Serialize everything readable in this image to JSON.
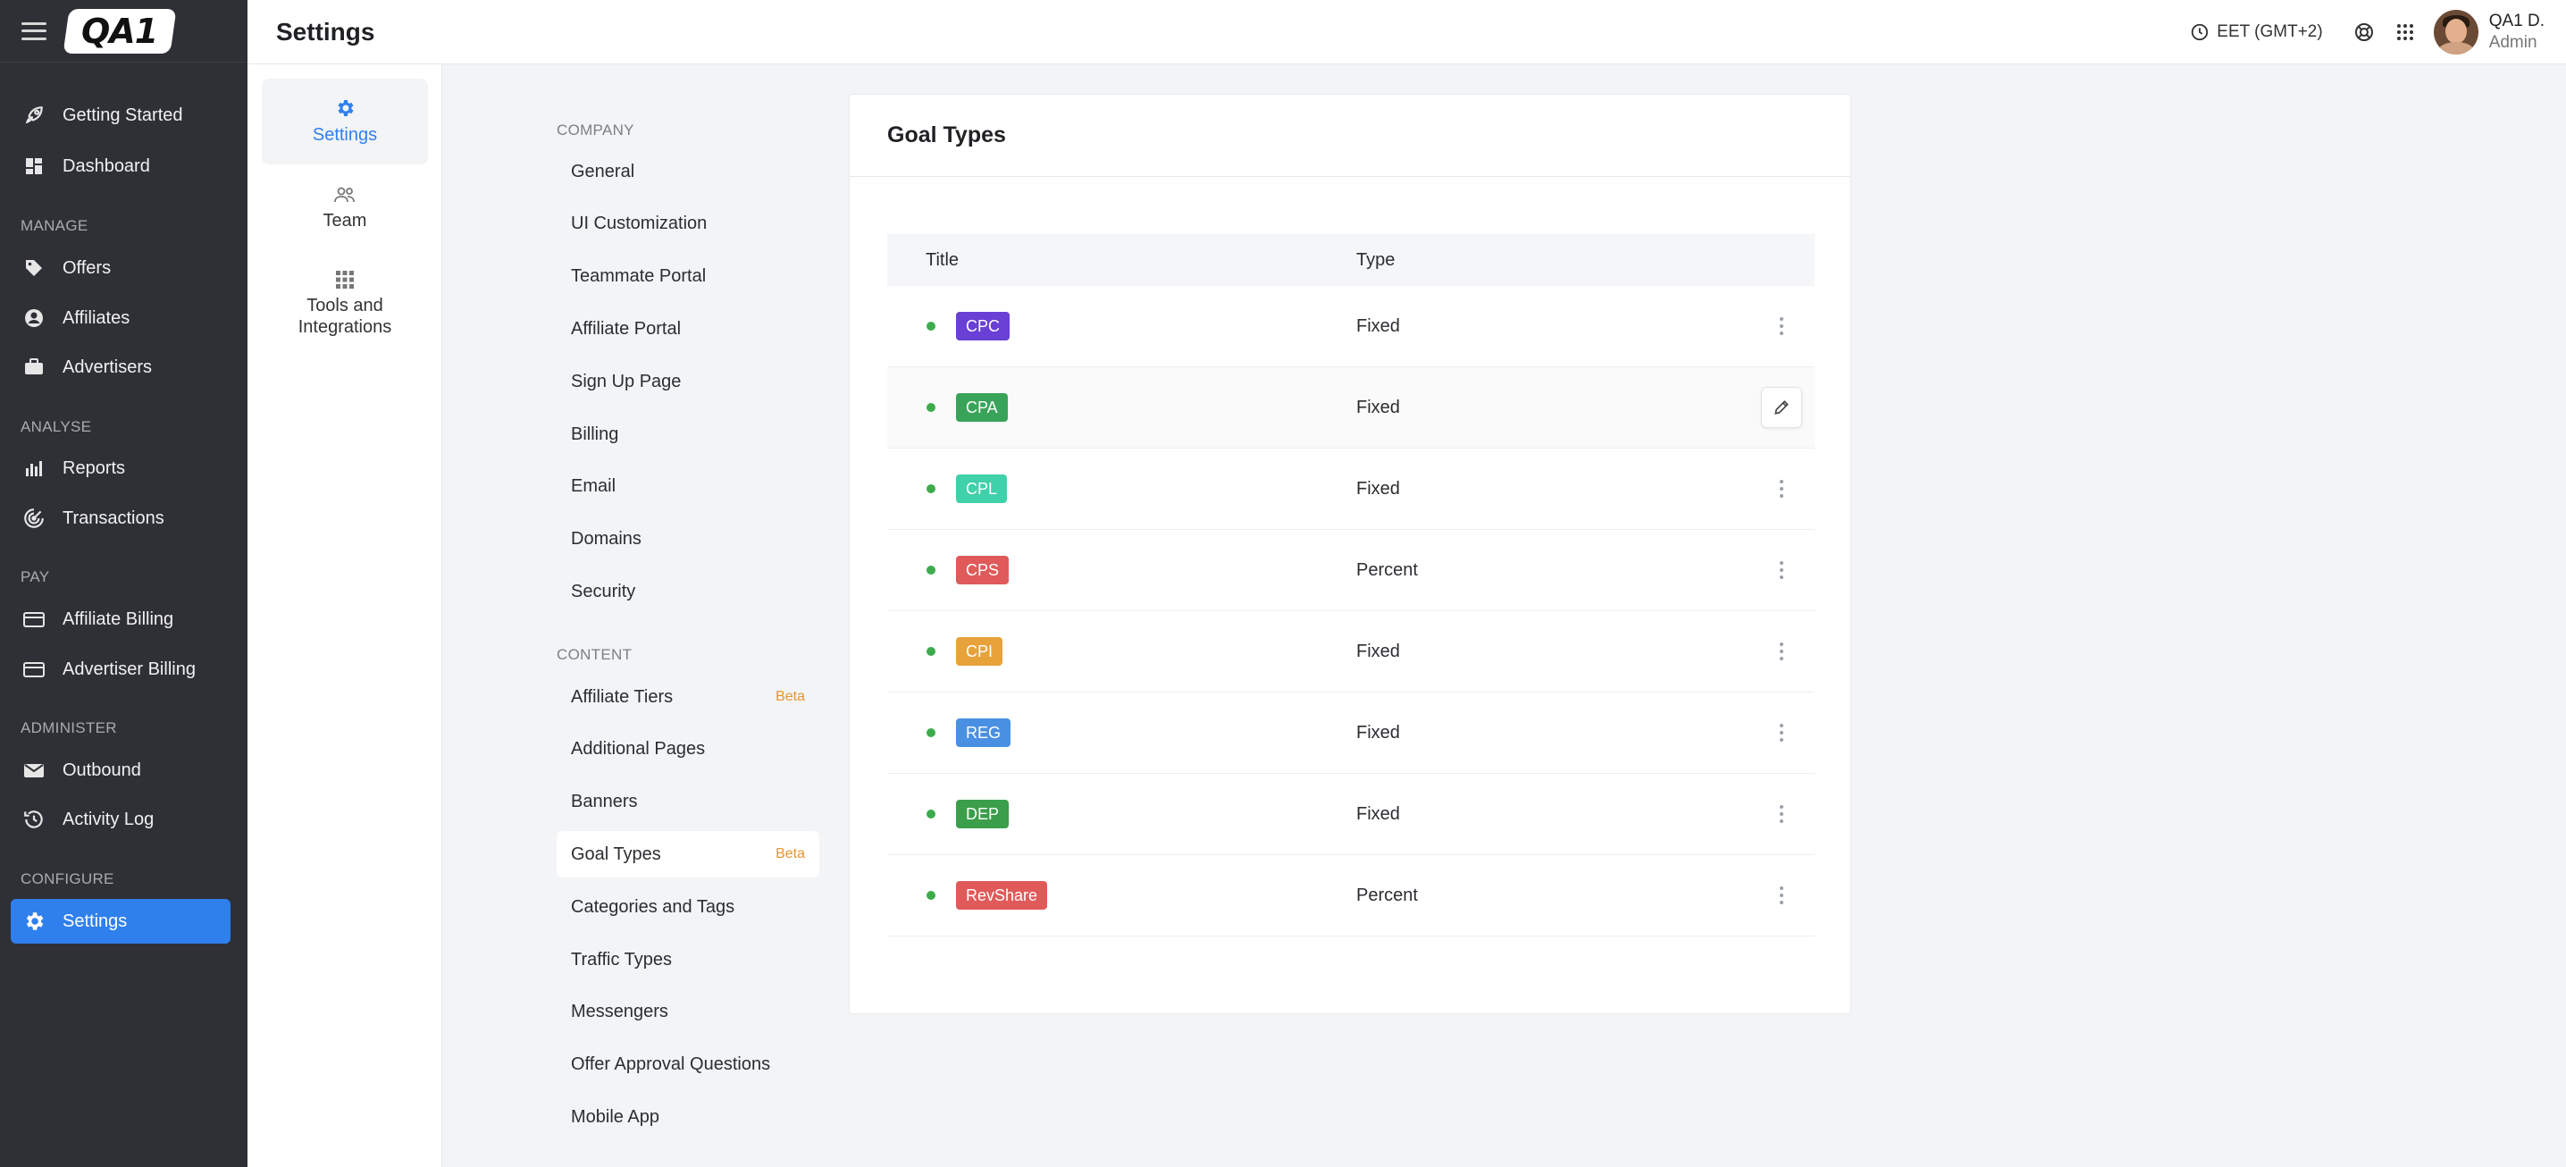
{
  "app": {
    "logo_text": "QA1",
    "page_title": "Settings"
  },
  "topbar": {
    "timezone": "EET (GMT+2)",
    "user_name": "QA1 D.",
    "user_role": "Admin"
  },
  "sidebar": {
    "items": [
      {
        "label": "Getting Started",
        "icon": "rocket-icon"
      },
      {
        "label": "Dashboard",
        "icon": "dashboard-icon"
      },
      {
        "section": "MANAGE"
      },
      {
        "label": "Offers",
        "icon": "tag-icon"
      },
      {
        "label": "Affiliates",
        "icon": "user-circle-icon"
      },
      {
        "label": "Advertisers",
        "icon": "briefcase-icon"
      },
      {
        "section": "ANALYSE"
      },
      {
        "label": "Reports",
        "icon": "bar-chart-icon"
      },
      {
        "label": "Transactions",
        "icon": "radar-icon"
      },
      {
        "section": "PAY"
      },
      {
        "label": "Affiliate Billing",
        "icon": "credit-card-icon"
      },
      {
        "label": "Advertiser Billing",
        "icon": "credit-card-icon"
      },
      {
        "section": "ADMINISTER"
      },
      {
        "label": "Outbound",
        "icon": "mail-icon"
      },
      {
        "label": "Activity Log",
        "icon": "history-icon"
      },
      {
        "section": "CONFIGURE"
      },
      {
        "label": "Settings",
        "icon": "gear-icon",
        "active": true
      }
    ]
  },
  "subnav": {
    "items": [
      {
        "label": "Settings",
        "icon": "gear-icon",
        "active": true
      },
      {
        "label": "Team",
        "icon": "team-icon"
      },
      {
        "label": "Tools and Integrations",
        "icon": "grid-icon"
      }
    ]
  },
  "settings_menu": {
    "company_label": "COMPANY",
    "company": [
      "General",
      "UI Customization",
      "Teammate Portal",
      "Affiliate Portal",
      "Sign Up Page",
      "Billing",
      "Email",
      "Domains",
      "Security"
    ],
    "content_label": "CONTENT",
    "content": [
      {
        "label": "Affiliate Tiers",
        "beta": "Beta"
      },
      {
        "label": "Additional Pages"
      },
      {
        "label": "Banners"
      },
      {
        "label": "Goal Types",
        "beta": "Beta",
        "active": true
      },
      {
        "label": "Categories and Tags"
      },
      {
        "label": "Traffic Types"
      },
      {
        "label": "Messengers"
      },
      {
        "label": "Offer Approval Questions"
      },
      {
        "label": "Mobile App"
      }
    ]
  },
  "goal_types": {
    "title": "Goal Types",
    "columns": {
      "title": "Title",
      "type": "Type"
    },
    "rows": [
      {
        "title": "CPC",
        "type": "Fixed",
        "color": "#6a3fd6"
      },
      {
        "title": "CPA",
        "type": "Fixed",
        "color": "#3aa35a",
        "hover": true
      },
      {
        "title": "CPL",
        "type": "Fixed",
        "color": "#3fd1a9"
      },
      {
        "title": "CPS",
        "type": "Percent",
        "color": "#e05a5a"
      },
      {
        "title": "CPI",
        "type": "Fixed",
        "color": "#e8a23a"
      },
      {
        "title": "REG",
        "type": "Fixed",
        "color": "#4a90e2"
      },
      {
        "title": "DEP",
        "type": "Fixed",
        "color": "#3a9e4a"
      },
      {
        "title": "RevShare",
        "type": "Percent",
        "color": "#e05a5a"
      }
    ]
  }
}
